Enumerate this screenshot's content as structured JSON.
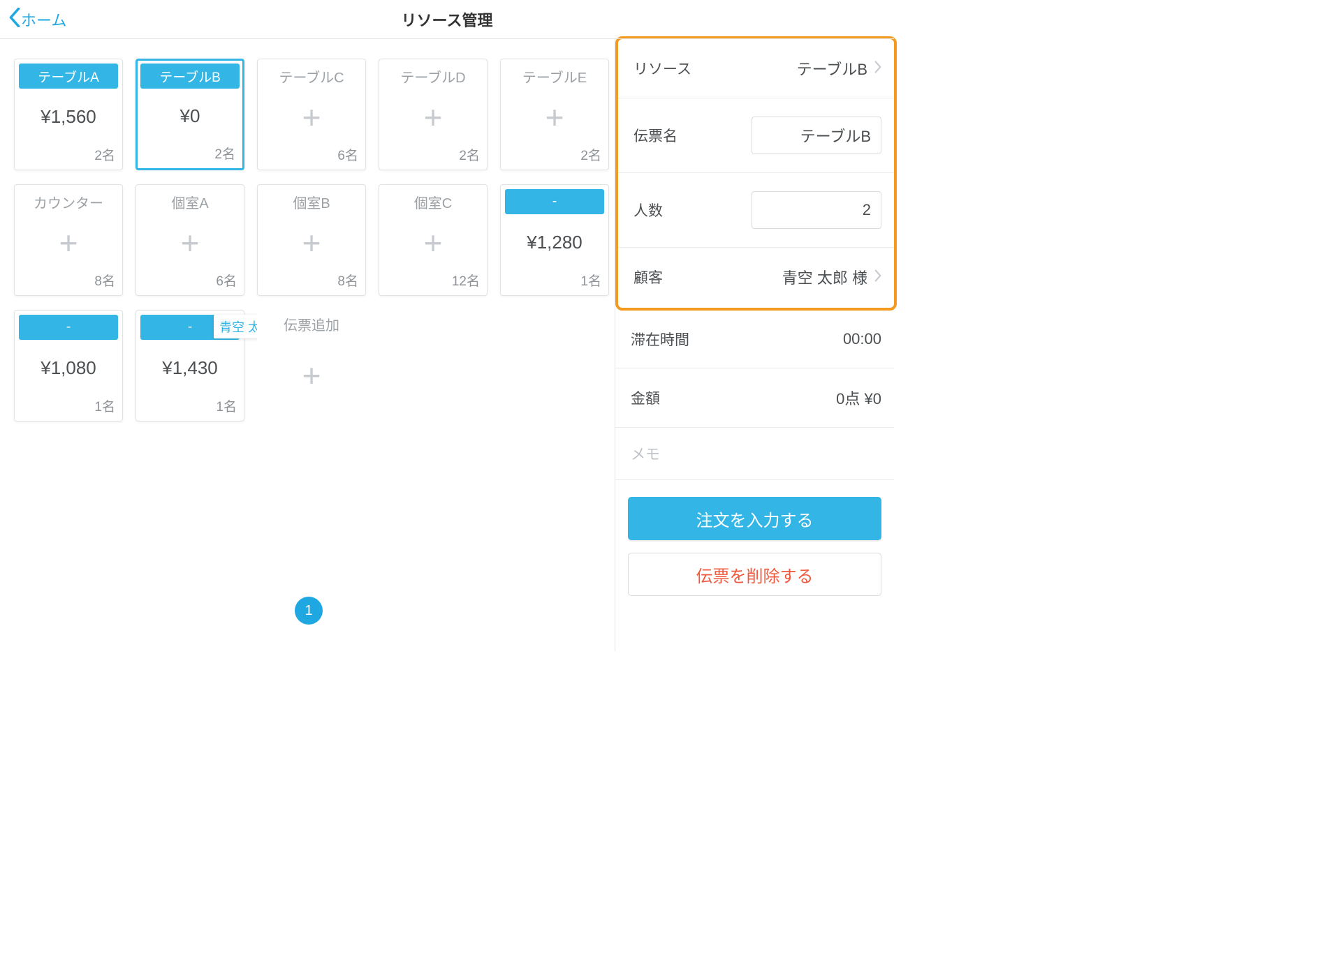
{
  "header": {
    "back_label": "ホーム",
    "title": "リソース管理"
  },
  "grid": {
    "cards": [
      {
        "label": "テーブルA",
        "kind": "active",
        "price": "¥1,560",
        "count": "2名"
      },
      {
        "label": "テーブルB",
        "kind": "active",
        "price": "¥0",
        "count": "2名",
        "selected": true
      },
      {
        "label": "テーブルC",
        "kind": "empty",
        "count": "6名"
      },
      {
        "label": "テーブルD",
        "kind": "empty",
        "count": "2名"
      },
      {
        "label": "テーブルE",
        "kind": "empty",
        "count": "2名"
      },
      {
        "label": "カウンター",
        "kind": "empty",
        "count": "8名"
      },
      {
        "label": "個室A",
        "kind": "empty",
        "count": "6名"
      },
      {
        "label": "個室B",
        "kind": "empty",
        "count": "8名"
      },
      {
        "label": "個室C",
        "kind": "empty",
        "count": "12名"
      },
      {
        "label": "-",
        "kind": "active",
        "price": "¥1,280",
        "count": "1名"
      },
      {
        "label": "-",
        "kind": "active",
        "price": "¥1,080",
        "count": "1名"
      },
      {
        "label": "-",
        "kind": "active",
        "price": "¥1,430",
        "count": "1名",
        "tag": "青空 太郎"
      },
      {
        "label": "伝票追加",
        "kind": "addslip"
      }
    ],
    "page": "1"
  },
  "panel": {
    "resource_label": "リソース",
    "resource_value": "テーブルB",
    "slipname_label": "伝票名",
    "slipname_value": "テーブルB",
    "people_label": "人数",
    "people_value": "2",
    "customer_label": "顧客",
    "customer_value": "青空 太郎 様",
    "stay_label": "滞在時間",
    "stay_value": "00:00",
    "amount_label": "金額",
    "amount_value": "0点  ¥0",
    "memo_placeholder": "メモ",
    "order_button": "注文を入力する",
    "delete_button": "伝票を削除する"
  }
}
